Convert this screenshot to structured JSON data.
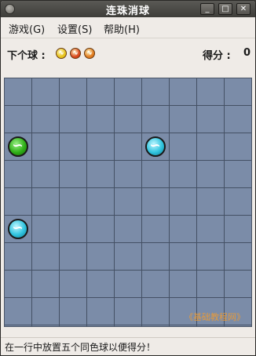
{
  "window": {
    "title": "连珠消球",
    "minimize": "_",
    "maximize": "□",
    "close": "✕"
  },
  "menu": [
    {
      "label": "游戏(G)"
    },
    {
      "label": "设置(S)"
    },
    {
      "label": "帮助(H)"
    }
  ],
  "info": {
    "next_label": "下个球 :",
    "next_balls": [
      {
        "color": "#e6c21a",
        "icon": "yellow-ball-icon"
      },
      {
        "color": "#d8451b",
        "icon": "red-ball-icon"
      },
      {
        "color": "#e07a1e",
        "icon": "orange-ball-icon"
      }
    ],
    "score_label": "得分 :",
    "score": "0"
  },
  "board": {
    "cols": 9,
    "rows": 9,
    "balls": [
      {
        "row": 3,
        "col": 1,
        "color": "green"
      },
      {
        "row": 3,
        "col": 6,
        "color": "cyan"
      },
      {
        "row": 6,
        "col": 1,
        "color": "cyan"
      }
    ],
    "watermark": "《基础教程网》"
  },
  "status": {
    "text": "在一行中放置五个同色球以便得分！"
  }
}
